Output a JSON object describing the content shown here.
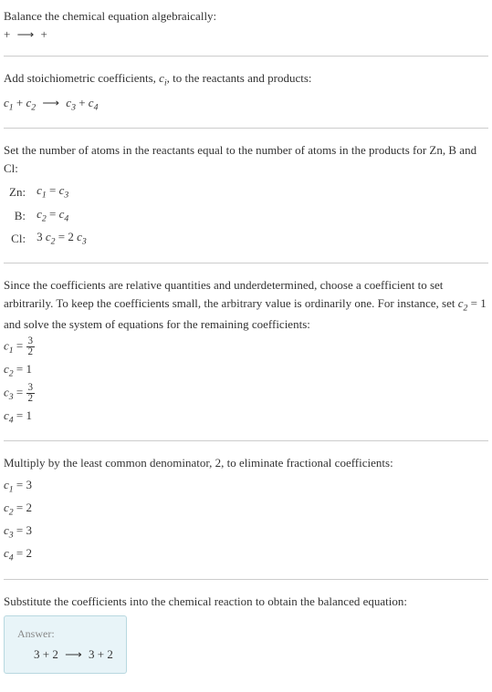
{
  "intro": {
    "line1": "Balance the chemical equation algebraically:",
    "line2_left": " + ",
    "line2_arrow": "⟶",
    "line2_right": " + "
  },
  "stoich": {
    "text": "Add stoichiometric coefficients, ",
    "ci": "c",
    "ci_sub": "i",
    "text2": ", to the reactants and products:",
    "eq_c1": "c",
    "eq_c1_sub": "1",
    "eq_plus1": " + ",
    "eq_c2": "c",
    "eq_c2_sub": "2",
    "eq_arrow": "⟶",
    "eq_c3": "c",
    "eq_c3_sub": "3",
    "eq_plus2": " + ",
    "eq_c4": "c",
    "eq_c4_sub": "4"
  },
  "atoms": {
    "text": "Set the number of atoms in the reactants equal to the number of atoms in the products for Zn, B and Cl:",
    "rows": [
      {
        "label": "Zn:",
        "lhs_c": "c",
        "lhs_sub": "1",
        "eq": " = ",
        "rhs_c": "c",
        "rhs_sub": "3"
      },
      {
        "label": "B:",
        "lhs_c": "c",
        "lhs_sub": "2",
        "eq": " = ",
        "rhs_c": "c",
        "rhs_sub": "4"
      },
      {
        "label": "Cl:",
        "lhs_pre": "3 ",
        "lhs_c": "c",
        "lhs_sub": "2",
        "eq": " = ",
        "rhs_pre": "2 ",
        "rhs_c": "c",
        "rhs_sub": "3"
      }
    ]
  },
  "underdetermined": {
    "text1": "Since the coefficients are relative quantities and underdetermined, choose a coefficient to set arbitrarily. To keep the coefficients small, the arbitrary value is ordinarily one. For instance, set ",
    "c2": "c",
    "c2_sub": "2",
    "text2": " = 1 and solve the system of equations for the remaining coefficients:",
    "coefs": [
      {
        "c": "c",
        "sub": "1",
        "eq": " = ",
        "frac_num": "3",
        "frac_den": "2"
      },
      {
        "c": "c",
        "sub": "2",
        "eq": " = 1"
      },
      {
        "c": "c",
        "sub": "3",
        "eq": " = ",
        "frac_num": "3",
        "frac_den": "2"
      },
      {
        "c": "c",
        "sub": "4",
        "eq": " = 1"
      }
    ]
  },
  "multiply": {
    "text": "Multiply by the least common denominator, 2, to eliminate fractional coefficients:",
    "coefs": [
      {
        "c": "c",
        "sub": "1",
        "eq": " = 3"
      },
      {
        "c": "c",
        "sub": "2",
        "eq": " = 2"
      },
      {
        "c": "c",
        "sub": "3",
        "eq": " = 3"
      },
      {
        "c": "c",
        "sub": "4",
        "eq": " = 2"
      }
    ]
  },
  "substitute": {
    "text": "Substitute the coefficients into the chemical reaction to obtain the balanced equation:"
  },
  "answer": {
    "label": "Answer:",
    "left": "3  + 2 ",
    "arrow": "⟶",
    "right": " 3  + 2"
  }
}
